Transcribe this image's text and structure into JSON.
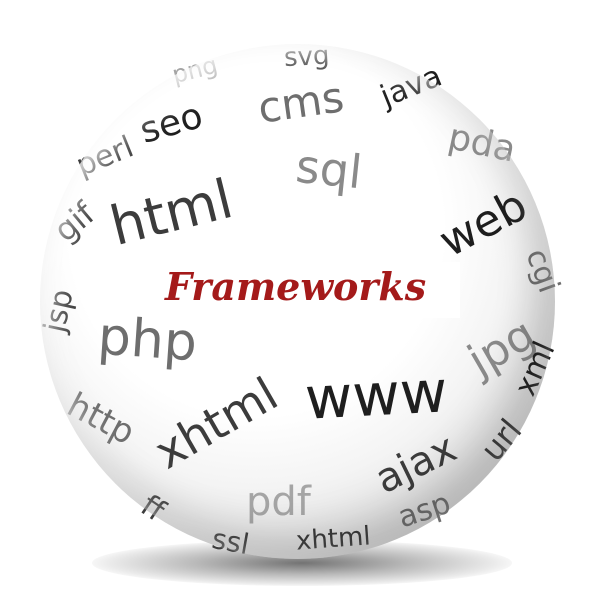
{
  "title": "Frameworks",
  "title_color": "#a41a1a",
  "words": [
    "svg",
    "png",
    "java",
    "seo",
    "cms",
    "perl",
    "sql",
    "pda",
    "html",
    "gif",
    "web",
    "cgi",
    "jsp",
    "jpg",
    "php",
    "xml",
    "www",
    "http",
    "xhtml",
    "url",
    "ajax",
    "pdf",
    "ssl",
    "xhtml",
    "asp",
    "ff"
  ]
}
